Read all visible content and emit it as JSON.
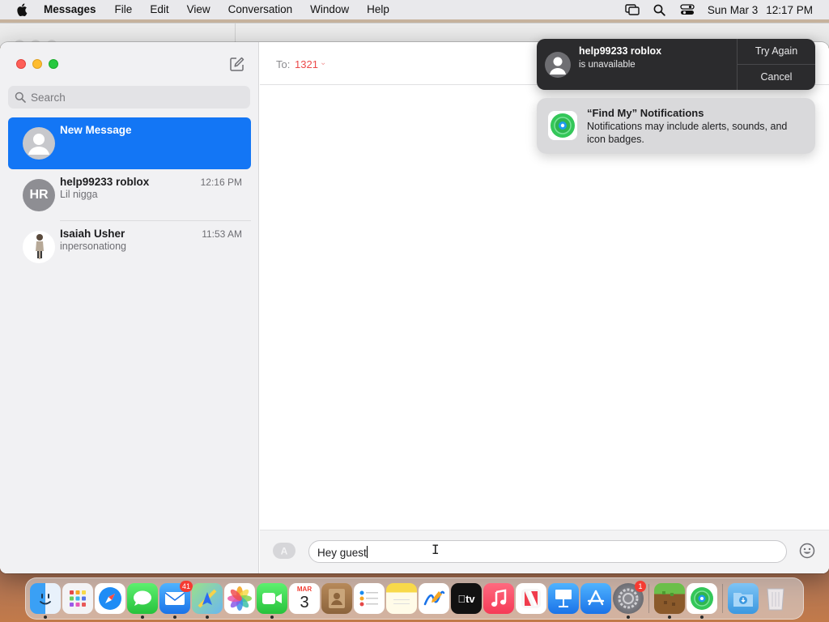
{
  "menubar": {
    "app_name": "Messages",
    "items": [
      "File",
      "Edit",
      "View",
      "Conversation",
      "Window",
      "Help"
    ],
    "date": "Sun Mar 3",
    "time": "12:17 PM"
  },
  "sidebar": {
    "search_placeholder": "Search",
    "conversations": [
      {
        "name": "New Message",
        "preview": "",
        "time": "",
        "selected": true
      },
      {
        "name": "help99233 roblox",
        "initials": "HR",
        "preview": "Lil nigga",
        "time": "12:16 PM",
        "selected": false
      },
      {
        "name": "Isaiah Usher",
        "preview": "inpersonationg",
        "time": "11:53 AM",
        "selected": false
      }
    ]
  },
  "main": {
    "to_label": "To:",
    "to_value": "1321",
    "message_text": "Hey guest"
  },
  "notifications": [
    {
      "title": "help99233 roblox",
      "subtitle": "is unavailable",
      "actions": [
        "Try Again",
        "Cancel"
      ]
    },
    {
      "title": "“Find My” Notifications",
      "body": "Notifications may include alerts, sounds, and icon badges."
    }
  ],
  "dock": {
    "mail_badge": "41",
    "settings_badge": "1",
    "calendar_month": "MAR",
    "calendar_day": "3",
    "tv_label": "tv"
  },
  "colors": {
    "selection": "#1376f5",
    "recipient_red": "#ec4a4a"
  }
}
